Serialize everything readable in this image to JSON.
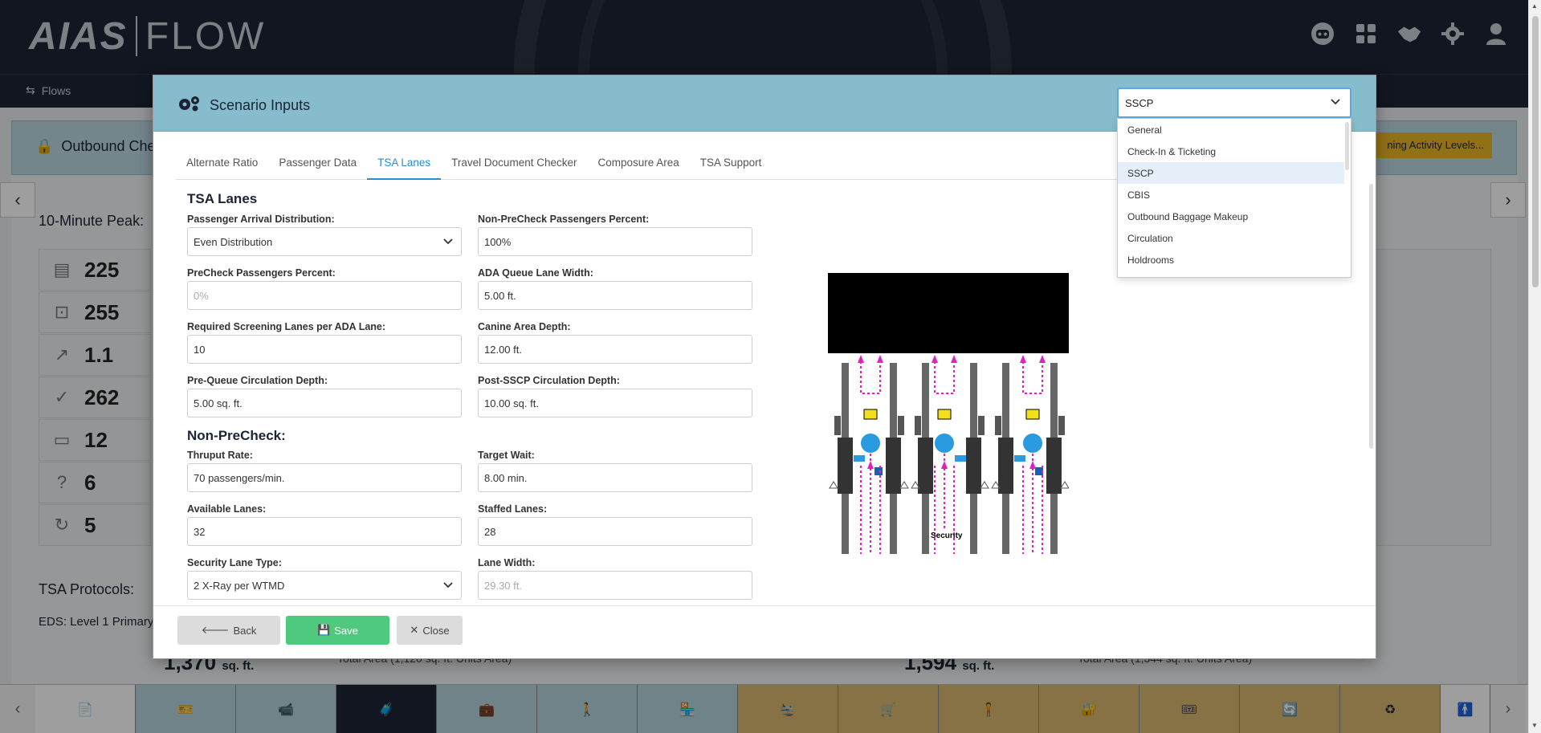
{
  "header": {
    "logo_left": "AIAS",
    "logo_right": "FLOW",
    "icons": [
      "robot-icon",
      "grid-icon",
      "handshake-icon",
      "gear-icon",
      "user-icon"
    ]
  },
  "nav": {
    "flows_label": "Flows"
  },
  "background": {
    "card_title": "Outbound Chec",
    "yellow_button": "ning Activity Levels...",
    "peak_label": "10-Minute Peak:",
    "stats": [
      "225",
      "255",
      "1.1",
      "262",
      "12",
      "6",
      "5"
    ],
    "tsa_protocols": "TSA Protocols:",
    "eds": "EDS: Level 1 Primary",
    "bottom_left_value": "1,370",
    "bottom_left_unit": "sq. ft.",
    "bottom_left_caption": "Total Area (1,120 sq. ft. Units Area)",
    "bottom_right_value": "1,594",
    "bottom_right_unit": "sq. ft.",
    "bottom_right_caption": "Total Area (1,344 sq. ft. Units Area)"
  },
  "modal": {
    "title": "Scenario Inputs",
    "selected": "SSCP",
    "dropdown_options": [
      "General",
      "Check-In & Ticketing",
      "SSCP",
      "CBIS",
      "Outbound Baggage Makeup",
      "Circulation",
      "Holdrooms"
    ],
    "tabs": [
      "Alternate Ratio",
      "Passenger Data",
      "TSA Lanes",
      "Travel Document Checker",
      "Composure Area",
      "TSA Support"
    ],
    "active_tab": "TSA Lanes",
    "section_tsa": "TSA Lanes",
    "section_nonprecheck": "Non-PreCheck:",
    "fields": {
      "arrival_dist": {
        "label": "Passenger Arrival Distribution:",
        "value": "Even Distribution"
      },
      "nonprecheck_pct": {
        "label": "Non-PreCheck Passengers Percent:",
        "value": "100%"
      },
      "precheck_pct": {
        "label": "PreCheck Passengers Percent:",
        "value": "0%"
      },
      "ada_width": {
        "label": "ADA Queue Lane Width:",
        "value": "5.00 ft."
      },
      "req_lanes": {
        "label": "Required Screening Lanes per ADA Lane:",
        "value": "10"
      },
      "canine_depth": {
        "label": "Canine Area Depth:",
        "value": "12.00 ft."
      },
      "prequeue_depth": {
        "label": "Pre-Queue Circulation Depth:",
        "value": "5.00 sq. ft."
      },
      "postsscp_depth": {
        "label": "Post-SSCP Circulation Depth:",
        "value": "10.00 sq. ft."
      },
      "thruput": {
        "label": "Thruput Rate:",
        "value": "70 passengers/min."
      },
      "target_wait": {
        "label": "Target Wait:",
        "value": "8.00 min."
      },
      "avail_lanes": {
        "label": "Available Lanes:",
        "value": "32"
      },
      "staffed_lanes": {
        "label": "Staffed Lanes:",
        "value": "28"
      },
      "lane_type": {
        "label": "Security Lane Type:",
        "value": "2 X-Ray per WTMD"
      },
      "lane_width": {
        "label": "Lane Width:",
        "value": "29.30 ft."
      }
    },
    "diagram_label": "Security",
    "buttons": {
      "back": "Back",
      "save": "Save",
      "close": "Close"
    }
  },
  "colors": {
    "accent": "#2a8bd0",
    "header": "#1c2434",
    "modal_head": "#86bccc",
    "save": "#4fc97e",
    "lane_arrow": "#e020c0"
  }
}
